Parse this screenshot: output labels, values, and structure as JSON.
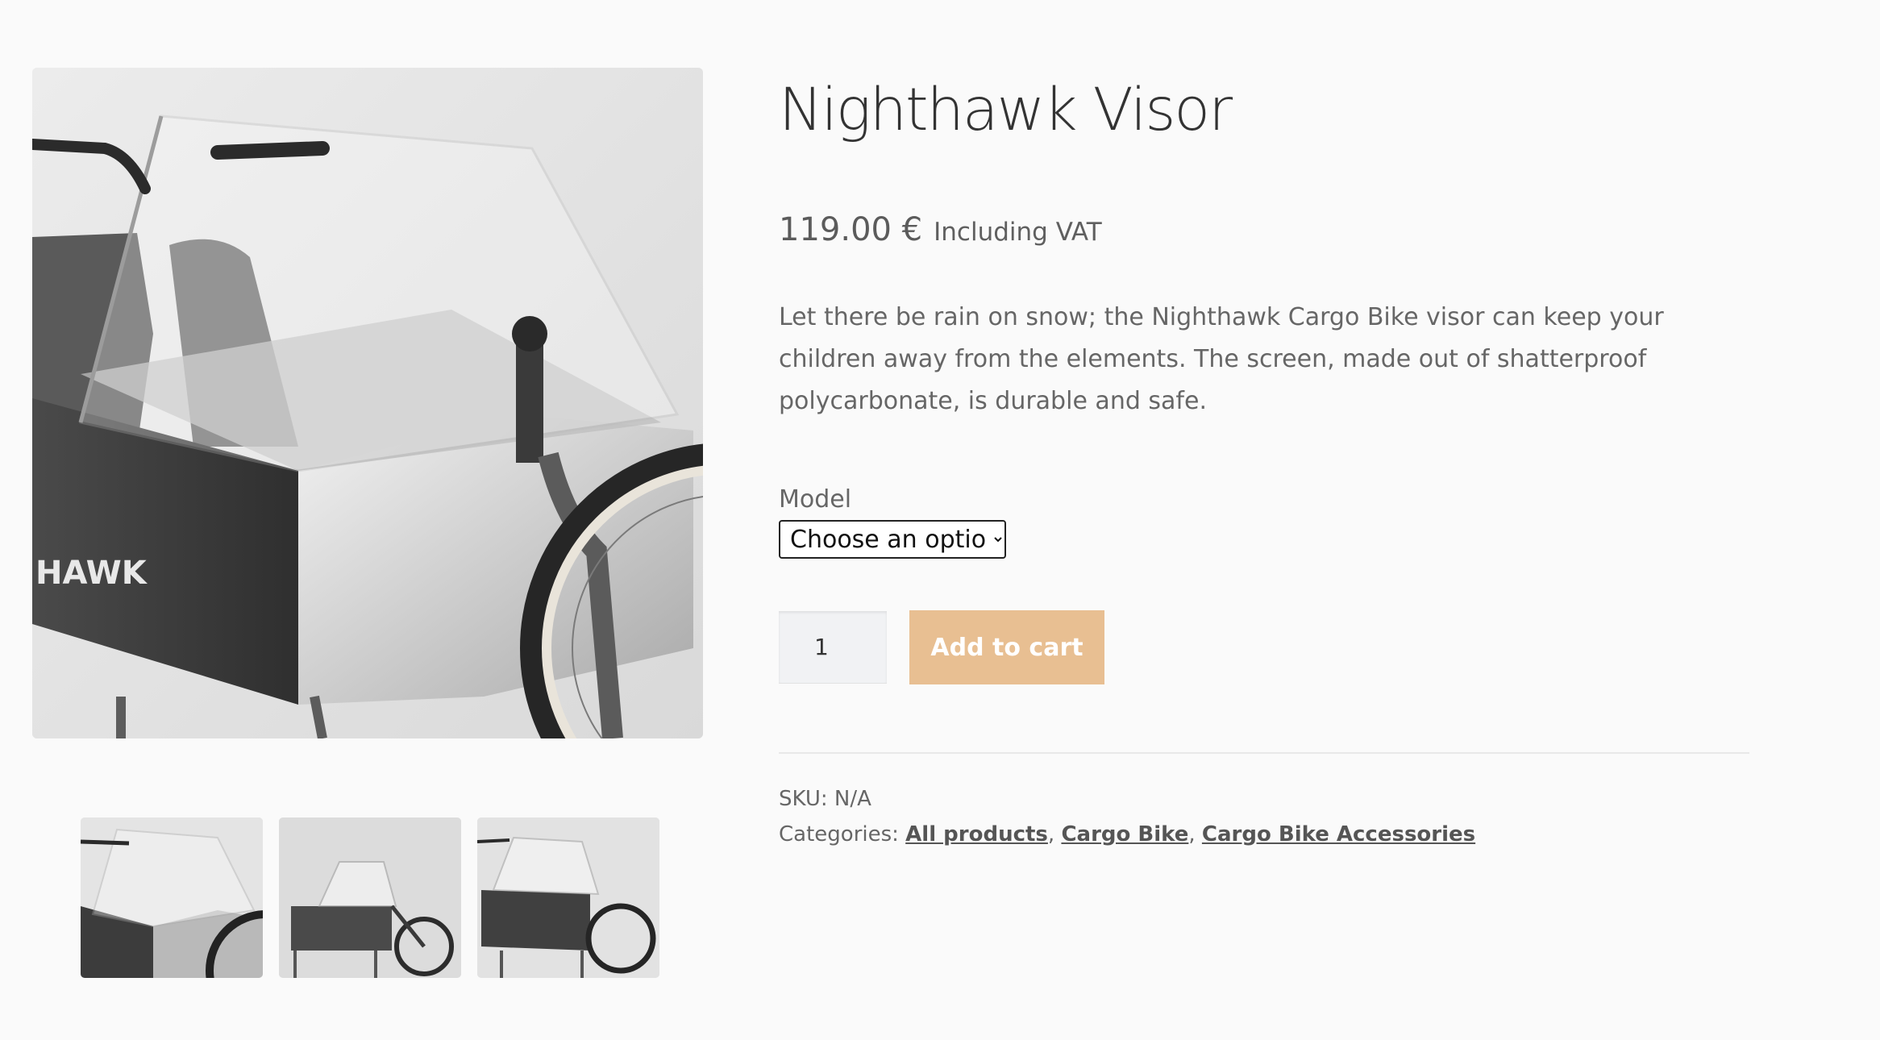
{
  "product": {
    "title": "Nighthawk Visor",
    "price": "119.00 €",
    "price_suffix": "Including VAT",
    "description": "Let there be rain on snow; the Nighthawk Cargo Bike visor can keep your children away from the elements. The screen, made out of shatterproof polycarbonate, is durable and safe.",
    "variation": {
      "label": "Model",
      "selected": "Choose an option"
    },
    "quantity": "1",
    "add_to_cart_label": "Add to cart",
    "brand_on_box": "HAWK",
    "meta": {
      "sku_label": "SKU:",
      "sku_value": "N/A",
      "categories_label": "Categories:",
      "categories": [
        "All products",
        "Cargo Bike",
        "Cargo Bike Accessories"
      ]
    }
  },
  "colors": {
    "button": "#e8bf92",
    "background": "#fafafa",
    "title": "#333333"
  }
}
